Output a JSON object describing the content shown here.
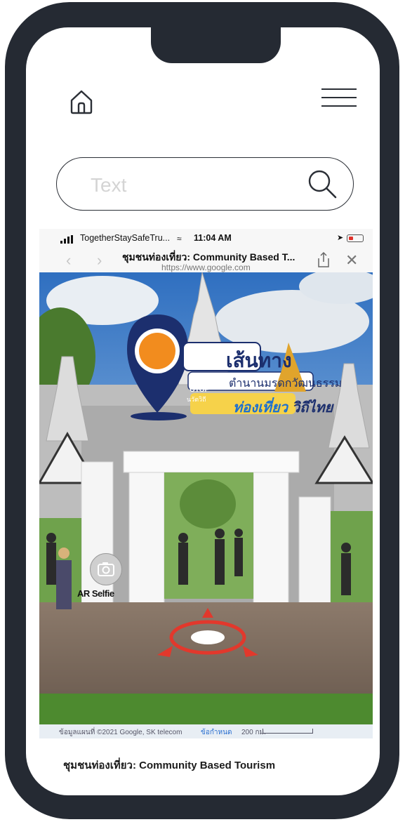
{
  "search": {
    "placeholder": "Text"
  },
  "screenshot": {
    "status_bar": {
      "carrier": "TogetherStaySafeTru...",
      "time": "11:04 AM"
    },
    "browser": {
      "page_title": "ชุมชนท่องเที่ยว: Community Based T...",
      "url": "https://www.google.com"
    },
    "poster": {
      "logo_text": "OTOP",
      "logo_subtext": "นวัตวิถี",
      "headline": "เส้นทาง",
      "subheadline": "ตำนานมรดกวัฒนธรรม",
      "tagline_part1": "ท่องเที่ยว",
      "tagline_part2": "วิถีไทย"
    },
    "ar_button_label": "AR Selfie",
    "map_footer": {
      "copyright": "ข้อมูลแผนที่ ©2021 Google, SK telecom",
      "terms": "ข้อกำหนด",
      "scale": "200 กม."
    }
  },
  "caption": "ชุมชนท่องเที่ยว: Community Based Tourism",
  "colors": {
    "frame": "#252a33",
    "screen": "#ffffff",
    "accent_orange": "#f28c1e",
    "accent_navy": "#1c2f6e",
    "target_red": "#e2382c"
  },
  "icons": {
    "home": "home-icon",
    "menu": "hamburger-menu-icon",
    "search": "search-icon",
    "camera": "camera-icon",
    "share": "share-icon",
    "close": "close-icon"
  }
}
